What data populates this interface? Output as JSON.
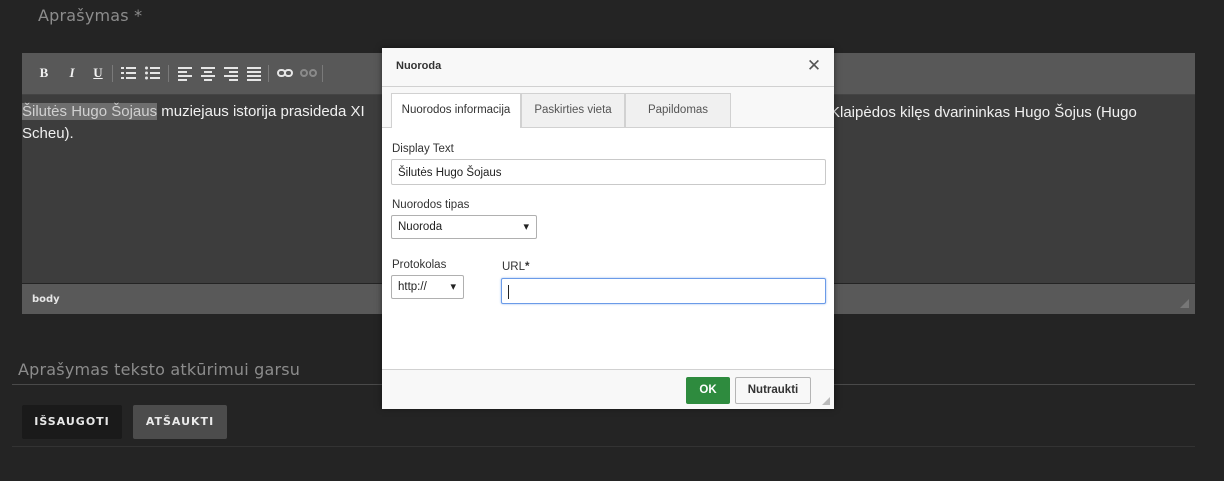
{
  "form": {
    "description_label": "Aprašymas *",
    "tts_label": "Aprašymas teksto atkūrimui garsu",
    "save_label": "IŠSAUGOTI",
    "cancel_label": "ATŠAUKTI"
  },
  "editor": {
    "toolbar": {
      "bold": "B",
      "italic": "I",
      "underline": "U",
      "icons": [
        "numbered-list-icon",
        "bulleted-list-icon",
        "align-left-icon",
        "align-center-icon",
        "align-right-icon",
        "align-justify-icon",
        "link-icon",
        "unlink-icon"
      ]
    },
    "content": {
      "highlighted": "Šilutės Hugo Šojaus",
      "line1_rest": " muziejaus istorija prasideda XI",
      "line1_right": "Klaipėdos kilęs dvarininkas Hugo Šojus (Hugo",
      "line2": "Scheu)."
    },
    "status_path": "body"
  },
  "dialog": {
    "title": "Nuoroda",
    "close_icon": "close-icon",
    "tabs": [
      {
        "label": "Nuorodos informacija",
        "active": true
      },
      {
        "label": "Paskirties vieta",
        "active": false
      },
      {
        "label": "Papildomas",
        "active": false
      }
    ],
    "display_text_label": "Display Text",
    "display_text_value": "Šilutės Hugo Šojaus",
    "link_type_label": "Nuorodos tipas",
    "link_type_value": "Nuoroda",
    "protocol_label": "Protokolas",
    "protocol_value": "http://",
    "url_label": "URL",
    "url_required": "*",
    "url_value": "",
    "ok_label": "OK",
    "cancel_label": "Nutraukti"
  },
  "colors": {
    "background": "#242424",
    "toolbar": "#585858",
    "editor_content": "#3d3d3d",
    "ok_button": "#2e8b3e",
    "focus_border": "#6b9be8"
  }
}
